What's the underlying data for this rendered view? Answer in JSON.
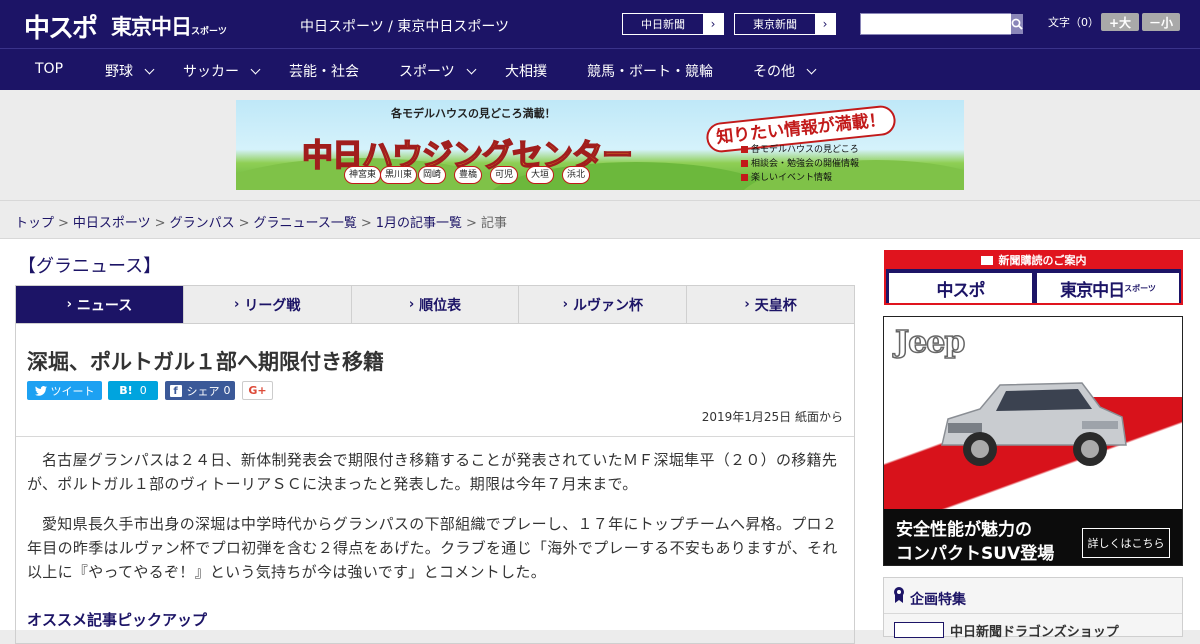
{
  "header": {
    "logo_primary": "中スポ",
    "logo_secondary": "東京中日",
    "logo_secondary_small": "スポーツ",
    "site_title": "中日スポーツ / 東京中日スポーツ",
    "paper_links": [
      {
        "label": "中日新聞"
      },
      {
        "label": "東京新聞"
      }
    ],
    "search": {
      "placeholder": "",
      "value": ""
    },
    "font_size": {
      "label": "文字（0）",
      "increase": "+大",
      "decrease": "－小"
    }
  },
  "nav": {
    "items": [
      {
        "label": "TOP",
        "has_dropdown": false
      },
      {
        "label": "野球",
        "has_dropdown": true
      },
      {
        "label": "サッカー",
        "has_dropdown": true
      },
      {
        "label": "芸能・社会",
        "has_dropdown": false
      },
      {
        "label": "スポーツ",
        "has_dropdown": true
      },
      {
        "label": "大相撲",
        "has_dropdown": false
      },
      {
        "label": "競馬・ボート・競輪",
        "has_dropdown": false
      },
      {
        "label": "その他",
        "has_dropdown": true
      }
    ]
  },
  "ad_banner": {
    "tagline": "各モデルハウスの見どころ満載！",
    "title": "中日ハウジングセンター",
    "bubble": "知りたい情報が満載！",
    "features": [
      "各モデルハウスの見どころ",
      "相談会・勉強会の開催情報",
      "楽しいイベント情報"
    ],
    "towns": [
      "神宮東",
      "黒川東",
      "岡崎",
      "豊橋",
      "可児",
      "大垣",
      "浜北"
    ]
  },
  "breadcrumb": {
    "links": [
      "トップ",
      "中日スポーツ",
      "グランパス",
      "グラニュース一覧",
      "1月の記事一覧"
    ],
    "current": "記事",
    "separator": ">"
  },
  "section": {
    "title": "【グラニュース】"
  },
  "tabs": [
    {
      "label": "ニュース",
      "active": true
    },
    {
      "label": "リーグ戦",
      "active": false
    },
    {
      "label": "順位表",
      "active": false
    },
    {
      "label": "ルヴァン杯",
      "active": false
    },
    {
      "label": "天皇杯",
      "active": false
    }
  ],
  "article": {
    "headline": "深堀、ポルトガル１部へ期限付き移籍",
    "share": {
      "tweet": "ツイート",
      "hatena_icon": "B!",
      "hatena_count": "0",
      "facebook": "シェア",
      "facebook_count": "0",
      "gplus": "G+"
    },
    "date": "2019年1月25日 紙面から",
    "paragraphs": [
      "名古屋グランパスは２４日、新体制発表会で期限付き移籍することが発表されていたＭＦ深堀隼平（２０）の移籍先が、ポルトガル１部のヴィトーリアＳＣに決まったと発表した。期限は今年７月末まで。",
      "愛知県長久手市出身の深堀は中学時代からグランパスの下部組織でプレーし、１７年にトップチームへ昇格。プロ２年目の昨季はルヴァン杯でプロ初弾を含む２得点をあげた。クラブを通じ「海外でプレーする不安もありますが、それ以上に『やってやるぞ！』という気持ちが今は強いです」とコメントした。"
    ],
    "recommend_heading": "オススメ記事ピックアップ"
  },
  "sidebar": {
    "subscribe": {
      "header": "新聞購読のご案内",
      "logo_left": "中スポ",
      "logo_right": "東京中日",
      "logo_right_small": "スポーツ"
    },
    "jeep_ad": {
      "brand": "Jeep",
      "line1": "安全性能が魅力の",
      "line2": "コンパクトSUV登場",
      "cta": "詳しくはこちら"
    },
    "kikaku": {
      "title": "企画特集",
      "item": "中日新聞ドラゴンズショップ"
    }
  },
  "colors": {
    "brand_navy": "#1c1466",
    "accent_red": "#e0141e",
    "twitter": "#1da1f2",
    "hatena": "#00a4de",
    "facebook": "#3b5998"
  }
}
